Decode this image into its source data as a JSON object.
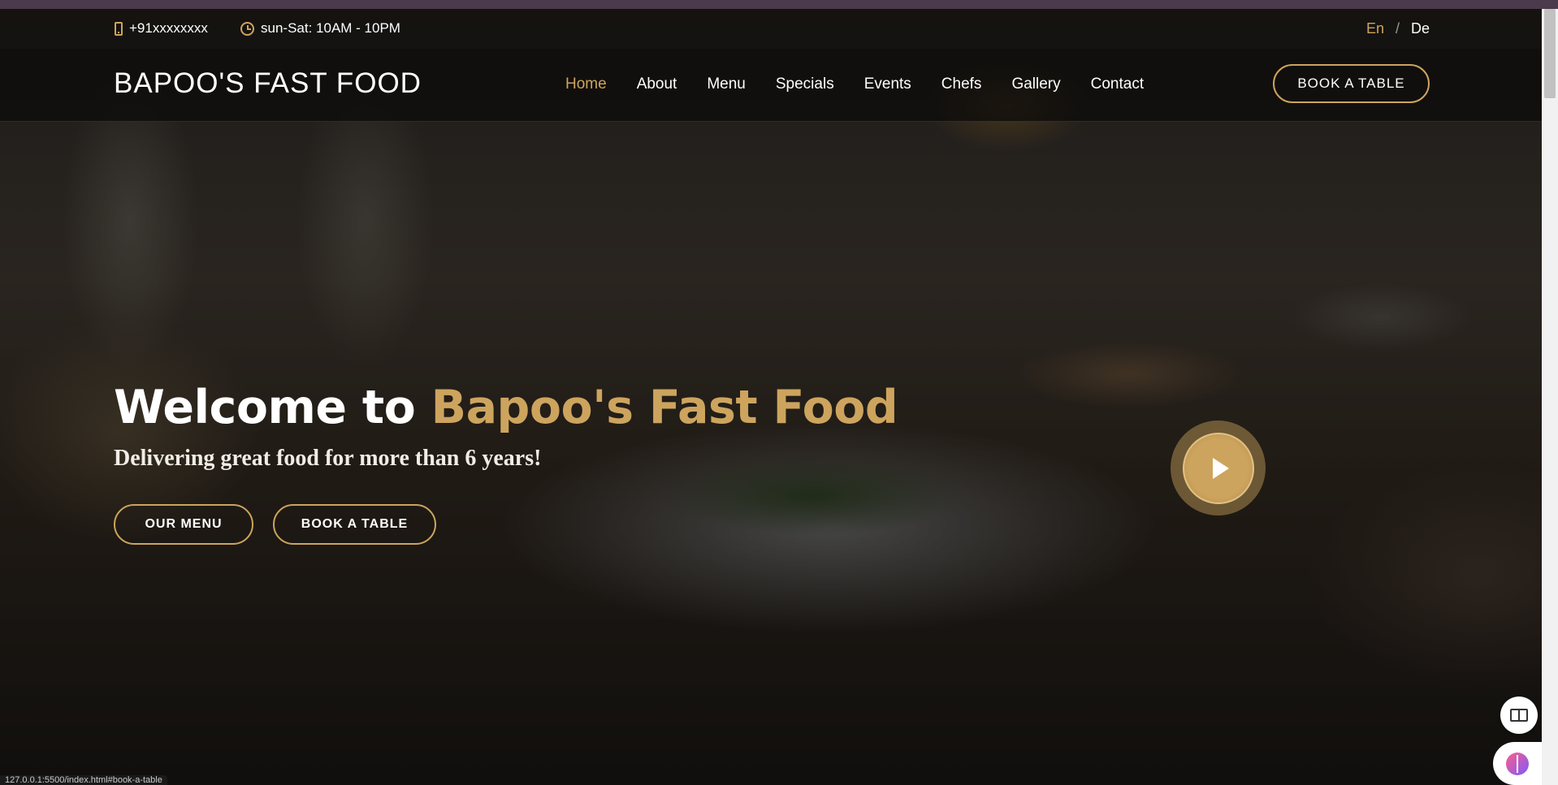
{
  "topbar": {
    "phone": "+91xxxxxxxx",
    "hours": "sun-Sat: 10AM - 10PM",
    "phone_icon": "phone-icon",
    "clock_icon": "clock-icon",
    "languages": {
      "en": "En",
      "separator": "/",
      "de": "De"
    }
  },
  "navbar": {
    "logo": "BAPOO'S FAST FOOD",
    "links": [
      "Home",
      "About",
      "Menu",
      "Specials",
      "Events",
      "Chefs",
      "Gallery",
      "Contact"
    ],
    "active": "Home",
    "book_button": "BOOK A TABLE"
  },
  "hero": {
    "welcome_prefix": "Welcome to ",
    "welcome_brand": "Bapoo's Fast Food",
    "tagline": "Delivering great food for more than 6 years!",
    "menu_button": "OUR MENU",
    "book_button": "BOOK A TABLE",
    "play_icon": "play-icon"
  },
  "status_url": "127.0.0.1:5500/index.html#book-a-table",
  "colors": {
    "accent": "#cda45e",
    "background": "#0c0a09"
  }
}
